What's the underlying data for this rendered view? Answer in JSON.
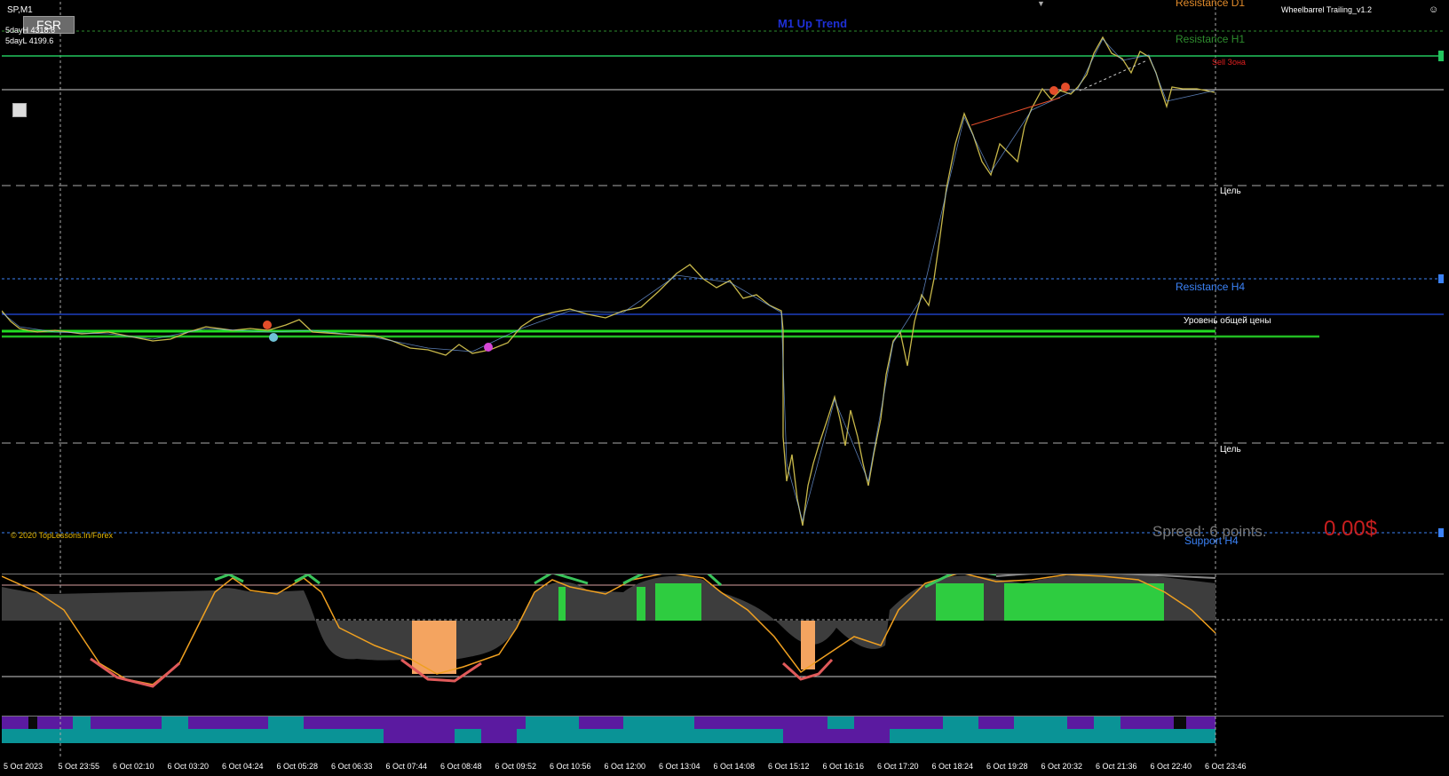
{
  "symbol": "SP,M1",
  "fsr_button": "FSR",
  "day_high": "5dayH 4318.6",
  "day_low": "5dayL 4199.6",
  "trend": "M1 Up Trend",
  "ea_name": "Wheelbarrel Trailing_v1.2",
  "labels": {
    "resistance_d1": "Resistance D1",
    "resistance_h1": "Resistance H1",
    "sell_zone": "Sell Зона",
    "target1": "Цель",
    "resistance_h4": "Resistance H4",
    "common_price": "Уровень общей цены",
    "target2": "Цель",
    "support_h4": "Support H4"
  },
  "copyright": "© 2020 TopLessons.In/Forex",
  "spread": "Spread: 6 points.",
  "profit": "0.00$",
  "x_axis": [
    "5 Oct 2023",
    "5 Oct 23:55",
    "6 Oct 02:10",
    "6 Oct 03:20",
    "6 Oct 04:24",
    "6 Oct 05:28",
    "6 Oct 06:33",
    "6 Oct 07:44",
    "6 Oct 08:48",
    "6 Oct 09:52",
    "6 Oct 10:56",
    "6 Oct 12:00",
    "6 Oct 13:04",
    "6 Oct 14:08",
    "6 Oct 15:12",
    "6 Oct 16:16",
    "6 Oct 17:20",
    "6 Oct 18:24",
    "6 Oct 19:28",
    "6 Oct 20:32",
    "6 Oct 21:36",
    "6 Oct 22:40",
    "6 Oct 23:46"
  ],
  "colors": {
    "background": "#000000",
    "candles": "#c8b84a",
    "line_blue": "#3b6fd6",
    "resistance_h1_line": "#22c55e",
    "green_band": "#22dd22",
    "orange": "#f4a460",
    "teal": "#0a9396",
    "purple": "#5b1aa0",
    "profit_red": "#c81e1e"
  }
}
